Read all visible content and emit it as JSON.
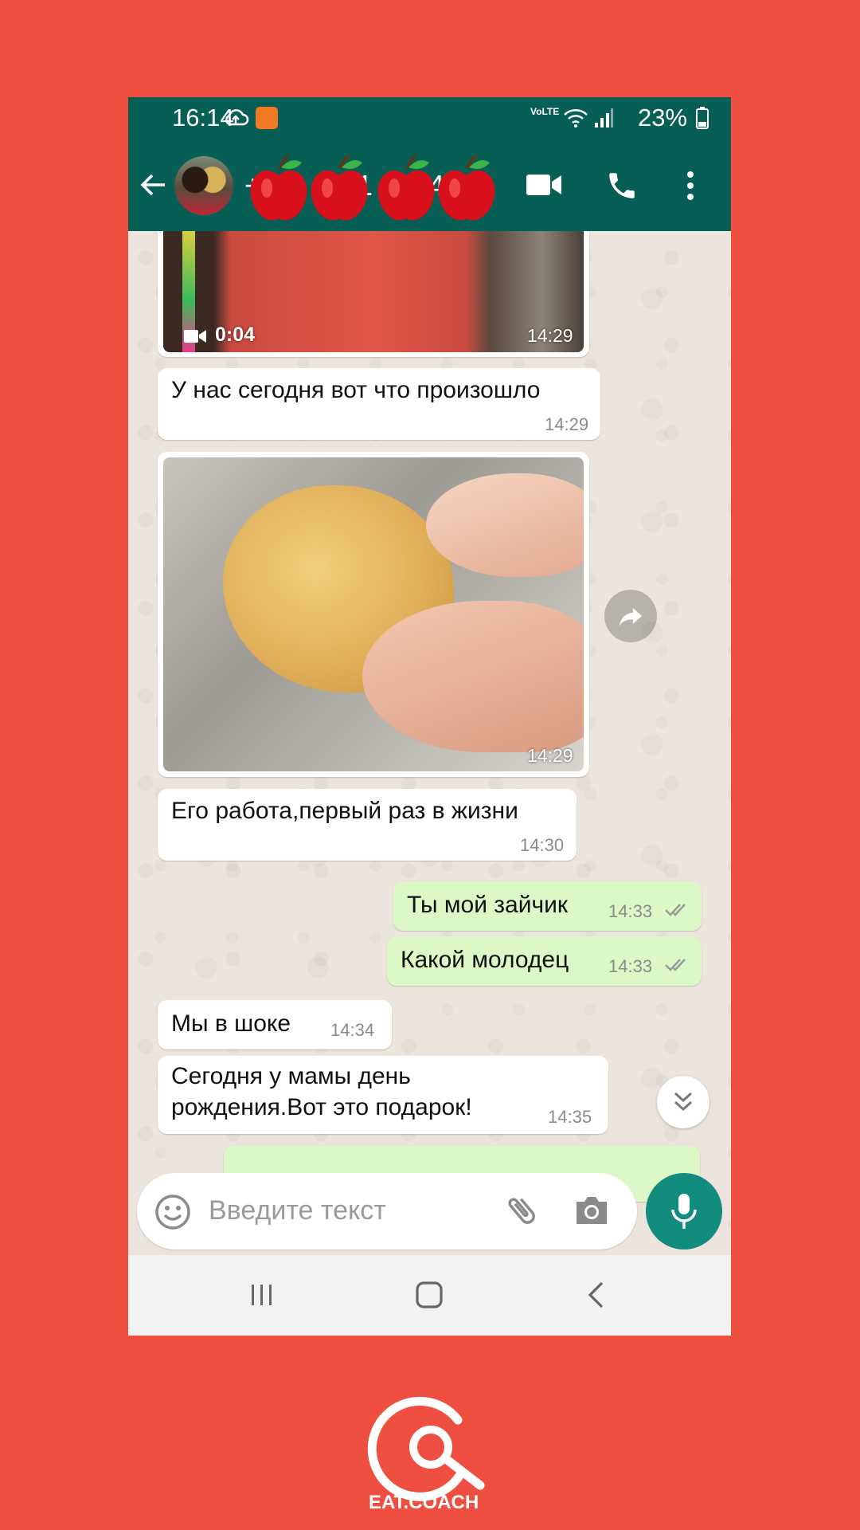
{
  "status_bar": {
    "time": "16:14",
    "battery": "23%",
    "network": "VoLTE"
  },
  "header": {
    "contact_name_masked": "+7 1 4",
    "back_icon": "arrow-left-icon",
    "video_icon": "video-call-icon",
    "call_icon": "phone-icon",
    "menu_icon": "more-vert-icon"
  },
  "messages": [
    {
      "type": "video",
      "direction": "in",
      "duration": "0:04",
      "time": "14:29"
    },
    {
      "type": "text",
      "direction": "in",
      "text": "У нас сегодня вот что произошло",
      "time": "14:29"
    },
    {
      "type": "image",
      "direction": "in",
      "time": "14:29"
    },
    {
      "type": "text",
      "direction": "in",
      "text": "Его работа,первый раз в жизни",
      "time": "14:30"
    },
    {
      "type": "text",
      "direction": "out",
      "text": "Ты мой зайчик",
      "time": "14:33"
    },
    {
      "type": "text",
      "direction": "out",
      "text": "Какой молодец",
      "time": "14:33"
    },
    {
      "type": "text",
      "direction": "in",
      "text": "Мы в шоке",
      "time": "14:34"
    },
    {
      "type": "text",
      "direction": "in",
      "text_line1": "Сегодня у мамы день",
      "text_line2": "рождения.Вот это подарок!",
      "time": "14:35"
    }
  ],
  "input": {
    "placeholder": "Введите текст"
  },
  "brand": {
    "name": "EAT.COACH"
  },
  "colors": {
    "background": "#ee4f40",
    "header": "#075e54",
    "accent": "#128c7e",
    "outgoing_bubble": "#dcf8c6",
    "incoming_bubble": "#ffffff"
  }
}
